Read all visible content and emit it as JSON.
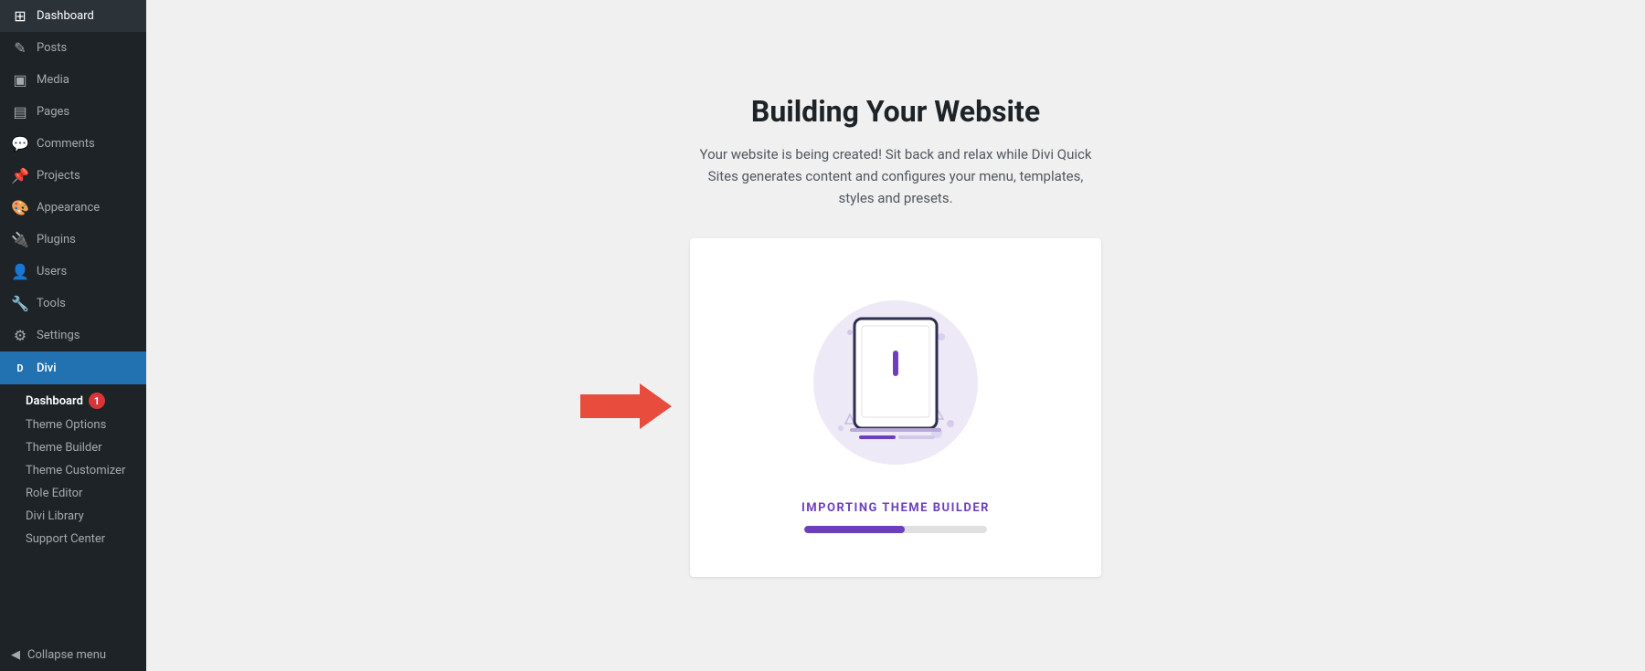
{
  "sidebar": {
    "items": [
      {
        "label": "Dashboard",
        "icon": "⊞"
      },
      {
        "label": "Posts",
        "icon": "✎"
      },
      {
        "label": "Media",
        "icon": "▣"
      },
      {
        "label": "Pages",
        "icon": "▤"
      },
      {
        "label": "Comments",
        "icon": "💬"
      },
      {
        "label": "Projects",
        "icon": "📌"
      },
      {
        "label": "Appearance",
        "icon": "🎨"
      },
      {
        "label": "Plugins",
        "icon": "🔌"
      },
      {
        "label": "Users",
        "icon": "👤"
      },
      {
        "label": "Tools",
        "icon": "🔧"
      },
      {
        "label": "Settings",
        "icon": "⚙"
      }
    ],
    "divi_label": "Divi",
    "divi_sub_items": [
      {
        "label": "Dashboard",
        "badge": "1"
      },
      {
        "label": "Theme Options"
      },
      {
        "label": "Theme Builder"
      },
      {
        "label": "Theme Customizer"
      },
      {
        "label": "Role Editor"
      },
      {
        "label": "Divi Library"
      },
      {
        "label": "Support Center"
      }
    ],
    "collapse_label": "Collapse menu"
  },
  "main": {
    "title": "Building Your Website",
    "subtitle": "Your website is being created! Sit back and relax while Divi Quick Sites generates content and configures your menu, templates, styles and presets.",
    "status_text": "IMPORTING THEME BUILDER",
    "progress_percent": 55,
    "colors": {
      "accent": "#6e3fbd",
      "progress_bg": "#e0e0e0",
      "circle_bg": "#ede9f6"
    }
  }
}
